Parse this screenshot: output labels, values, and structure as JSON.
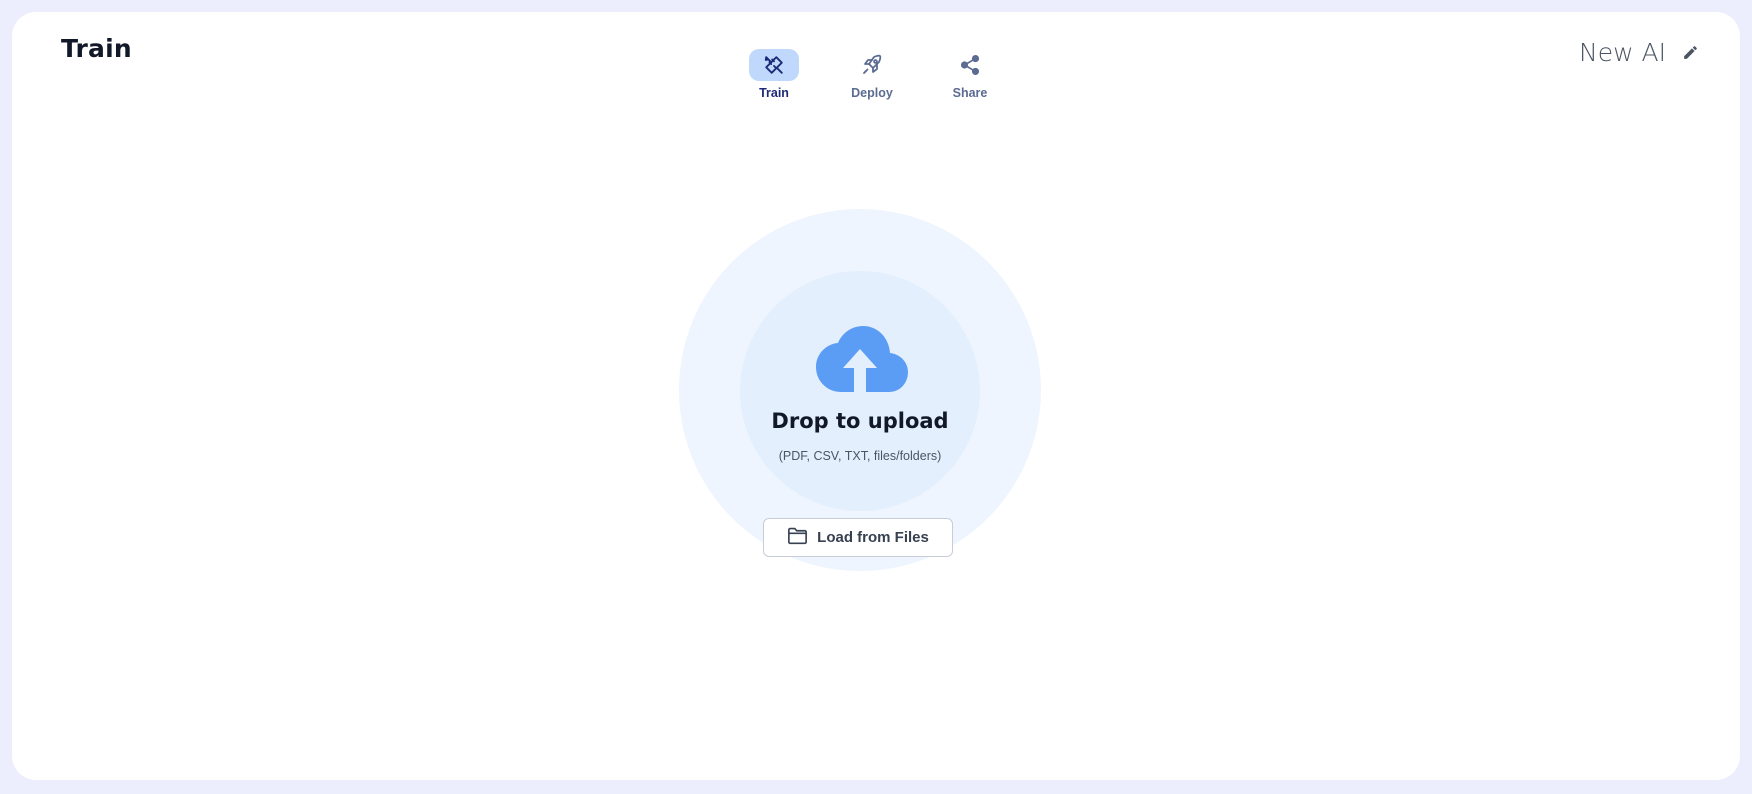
{
  "header": {
    "title": "Train",
    "model_name": "New AI"
  },
  "nav": {
    "tabs": [
      {
        "label": "Train",
        "icon": "train-tools-icon",
        "active": true
      },
      {
        "label": "Deploy",
        "icon": "rocket-icon",
        "active": false
      },
      {
        "label": "Share",
        "icon": "share-icon",
        "active": false
      }
    ]
  },
  "upload": {
    "title": "Drop to upload",
    "subtitle": "(PDF, CSV, TXT, files/folders)",
    "button_label": "Load from Files",
    "icon": "cloud-upload-icon"
  },
  "colors": {
    "page_bg": "#ecedfd",
    "card_bg": "#ffffff",
    "accent": "#5b9cf5",
    "active_tab_bg": "#bfd8fb",
    "active_tab_text": "#1e2a78",
    "inactive_tab_text": "#5b6b91"
  }
}
